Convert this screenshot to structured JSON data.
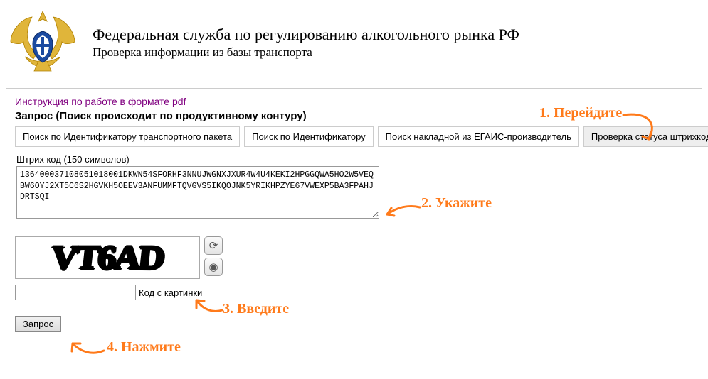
{
  "header": {
    "title": "Федеральная служба по регулированию алкогольного рынка РФ",
    "subtitle": "Проверка информации из базы транспорта"
  },
  "main": {
    "instruction_link": "Инструкция по работе в формате pdf",
    "query_title": "Запрос (Поиск происходит по продуктивному контуру)",
    "tabs": [
      {
        "label": "Поиск по Идентификатору транспортного пакета",
        "active": false
      },
      {
        "label": "Поиск по Идентификатору",
        "active": false
      },
      {
        "label": "Поиск накладной из ЕГАИС-производитель",
        "active": false
      },
      {
        "label": "Проверка статуса штрихкода",
        "active": true
      }
    ],
    "barcode_label": "Штрих код (150 символов)",
    "barcode_value": "136400037108051018001DKWN54SFORHF3NNUJWGNXJXUR4W4U4KEKI2HPGGQWA5HO2W5VEQBW6OYJ2XT5C6S2HGVKH5OEEV3ANFUMMFTQVGVS5IKQOJNK5YRIKHPZYE67VWEXP5BA3FPAHJDRTSQI",
    "captcha_text": "VT6AD",
    "captcha_label": "Код с картинки",
    "captcha_value": "",
    "submit_label": "Запрос"
  },
  "annotations": {
    "a1": "1. Перейдите",
    "a2": "2. Укажите",
    "a3": "3. Введите",
    "a4": "4. Нажмите"
  },
  "colors": {
    "annotation": "#ff7a1a"
  }
}
